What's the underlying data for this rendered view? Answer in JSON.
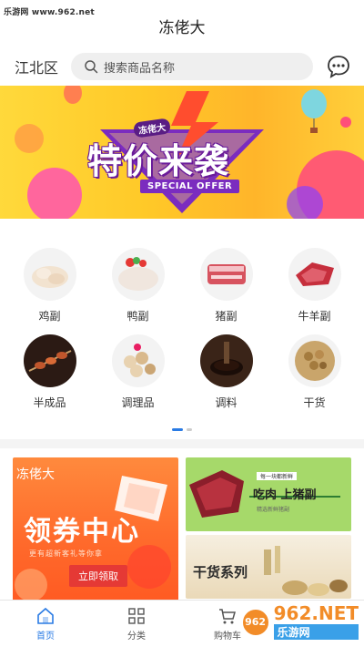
{
  "watermark_top": "乐游网 www.962.net",
  "header": {
    "title": "冻佬大"
  },
  "search": {
    "location": "江北区",
    "placeholder": "搜索商品名称"
  },
  "banner": {
    "brand": "冻佬大",
    "title": "特价来袭",
    "subtitle": "SPECIAL OFFER"
  },
  "categories": [
    {
      "label": "鸡副",
      "icon": "chicken-icon"
    },
    {
      "label": "鸭副",
      "icon": "duck-icon"
    },
    {
      "label": "猪副",
      "icon": "pork-icon"
    },
    {
      "label": "牛羊副",
      "icon": "beef-icon"
    },
    {
      "label": "半成品",
      "icon": "skewer-icon"
    },
    {
      "label": "调理品",
      "icon": "meatball-icon"
    },
    {
      "label": "调料",
      "icon": "sauce-icon"
    },
    {
      "label": "干货",
      "icon": "dried-goods-icon"
    }
  ],
  "pager": {
    "count": 2,
    "active": 0
  },
  "promos": {
    "left": {
      "brand": "冻佬大",
      "title": "领券中心",
      "sub": "更有超新客礼等你拿",
      "button": "立即领取"
    },
    "right_top": {
      "title": "吃肉 上猪副",
      "tag": "每一块都新鲜",
      "note": "精选新鲜猪副"
    },
    "right_bottom": {
      "title": "干货系列"
    }
  },
  "tabbar": [
    {
      "label": "首页",
      "icon": "home-icon",
      "active": true
    },
    {
      "label": "分类",
      "icon": "grid-icon",
      "active": false
    },
    {
      "label": "购物车",
      "icon": "cart-icon",
      "active": false
    }
  ],
  "watermark_bottom": {
    "logo": "962",
    "big": "962.NET",
    "small": "乐游网"
  },
  "colors": {
    "accent": "#2a7be4",
    "banner_purple": "#6a1b9a",
    "promo_orange": "#ff6b2c"
  }
}
